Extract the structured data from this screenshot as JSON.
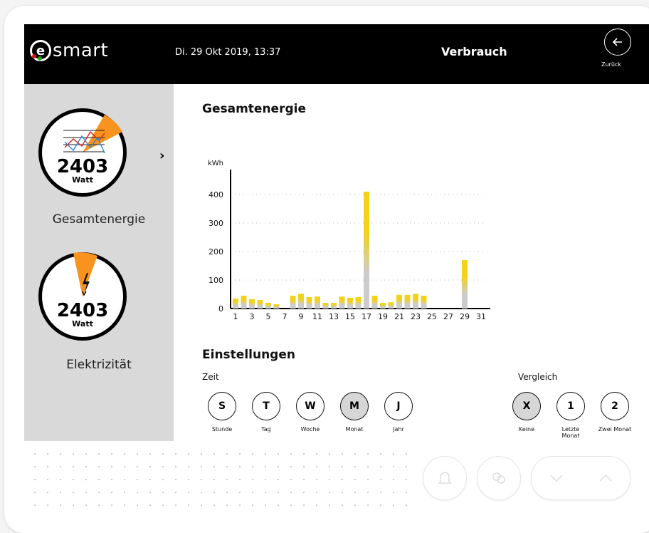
{
  "app": {
    "logo_letter": "e",
    "logo_text": "smart"
  },
  "header": {
    "datetime": "Di. 29 Okt 2019, 13:37",
    "title": "Verbrauch",
    "back_label": "Zurück",
    "back_icon": "arrow-left-icon"
  },
  "sidebar": {
    "items": [
      {
        "value": "2403",
        "unit": "Watt",
        "label": "Gesamtenergie",
        "icon": "line-chart-icon",
        "accent": "#f7931e"
      },
      {
        "value": "2403",
        "unit": "Watt",
        "label": "Elektrizität",
        "icon": "lightning-icon",
        "accent": "#f7931e"
      }
    ]
  },
  "main": {
    "chart_title": "Gesamtenergie",
    "settings_title": "Einstellungen",
    "zeit_label": "Zeit",
    "vergleich_label": "Vergleich",
    "zeit_options": [
      {
        "letter": "S",
        "label": "Stunde",
        "selected": false
      },
      {
        "letter": "T",
        "label": "Tag",
        "selected": false
      },
      {
        "letter": "W",
        "label": "Woche",
        "selected": false
      },
      {
        "letter": "M",
        "label": "Monat",
        "selected": true
      },
      {
        "letter": "J",
        "label": "Jahr",
        "selected": false
      }
    ],
    "vergleich_options": [
      {
        "letter": "X",
        "label": "Keine",
        "selected": true
      },
      {
        "letter": "1",
        "label": "Letzte Monat",
        "selected": false
      },
      {
        "letter": "2",
        "label": "Zwei Monat",
        "selected": false
      }
    ]
  },
  "chart_data": {
    "type": "bar",
    "ylabel": "kWh",
    "ylim": [
      0,
      420
    ],
    "yticks": [
      0,
      100,
      200,
      300,
      400
    ],
    "xticks": [
      1,
      3,
      5,
      7,
      9,
      11,
      13,
      15,
      17,
      19,
      21,
      23,
      25,
      27,
      29,
      31
    ],
    "colors": {
      "base": "#cccccc",
      "top": "#f2d21b"
    },
    "days": [
      1,
      2,
      3,
      4,
      5,
      6,
      7,
      8,
      9,
      10,
      11,
      12,
      13,
      14,
      15,
      16,
      17,
      18,
      19,
      20,
      21,
      22,
      23,
      24,
      25,
      26,
      27,
      28,
      29,
      30,
      31
    ],
    "values": [
      35,
      45,
      33,
      30,
      20,
      15,
      0,
      45,
      52,
      40,
      42,
      20,
      20,
      42,
      38,
      40,
      410,
      45,
      20,
      22,
      48,
      48,
      52,
      45,
      0,
      0,
      0,
      0,
      170,
      0,
      0
    ]
  }
}
